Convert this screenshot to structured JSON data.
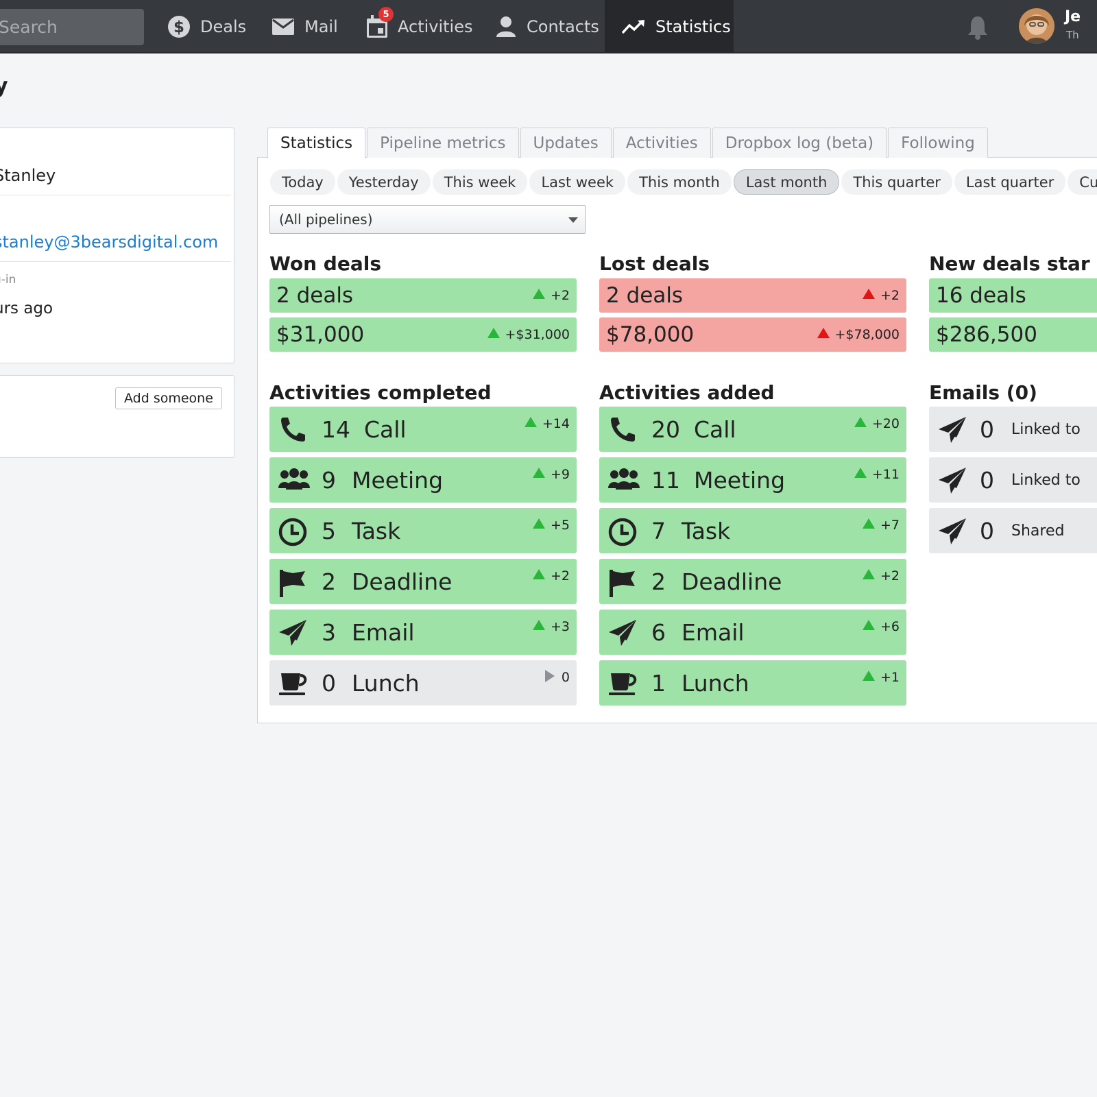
{
  "nav": {
    "search_placeholder": "Search",
    "items": [
      {
        "label": "Deals",
        "icon": "dollar-icon"
      },
      {
        "label": "Mail",
        "icon": "mail-icon"
      },
      {
        "label": "Activities",
        "icon": "calendar-icon",
        "badge": "5"
      },
      {
        "label": "Contacts",
        "icon": "person-icon"
      },
      {
        "label": "Statistics",
        "icon": "trend-icon",
        "active": true
      }
    ],
    "user_name": "Je",
    "user_company": "Th"
  },
  "page_title": "y",
  "profile": {
    "name": "Stanley",
    "email": "stanley@3bearsdigital.com",
    "last_login_label": "g-in",
    "last_login_value": "urs ago"
  },
  "followers": {
    "add_button": "Add someone"
  },
  "tabs": [
    "Statistics",
    "Pipeline metrics",
    "Updates",
    "Activities",
    "Dropbox log (beta)",
    "Following"
  ],
  "periods": [
    "Today",
    "Yesterday",
    "This week",
    "Last week",
    "This month",
    "Last month",
    "This quarter",
    "Last quarter",
    "Cust"
  ],
  "active_period": "Last month",
  "pipeline_select": "(All pipelines)",
  "won": {
    "title": "Won deals",
    "count": "2 deals",
    "count_delta": "+2",
    "value": "$31,000",
    "value_delta": "+$31,000"
  },
  "lost": {
    "title": "Lost deals",
    "count": "2 deals",
    "count_delta": "+2",
    "value": "$78,000",
    "value_delta": "+$78,000"
  },
  "new_deals": {
    "title": "New deals star",
    "count": "16 deals",
    "value": "$286,500"
  },
  "activities_completed": {
    "title": "Activities completed",
    "rows": [
      {
        "icon": "phone-icon",
        "num": "14",
        "label": "Call",
        "delta": "+14",
        "trend": "up"
      },
      {
        "icon": "group-icon",
        "num": "9",
        "label": "Meeting",
        "delta": "+9",
        "trend": "up"
      },
      {
        "icon": "clock-icon",
        "num": "5",
        "label": "Task",
        "delta": "+5",
        "trend": "up"
      },
      {
        "icon": "flag-icon",
        "num": "2",
        "label": "Deadline",
        "delta": "+2",
        "trend": "up"
      },
      {
        "icon": "send-icon",
        "num": "3",
        "label": "Email",
        "delta": "+3",
        "trend": "up"
      },
      {
        "icon": "coffee-icon",
        "num": "0",
        "label": "Lunch",
        "delta": "0",
        "trend": "flat"
      }
    ]
  },
  "activities_added": {
    "title": "Activities added",
    "rows": [
      {
        "icon": "phone-icon",
        "num": "20",
        "label": "Call",
        "delta": "+20",
        "trend": "up"
      },
      {
        "icon": "group-icon",
        "num": "11",
        "label": "Meeting",
        "delta": "+11",
        "trend": "up"
      },
      {
        "icon": "clock-icon",
        "num": "7",
        "label": "Task",
        "delta": "+7",
        "trend": "up"
      },
      {
        "icon": "flag-icon",
        "num": "2",
        "label": "Deadline",
        "delta": "+2",
        "trend": "up"
      },
      {
        "icon": "send-icon",
        "num": "6",
        "label": "Email",
        "delta": "+6",
        "trend": "up"
      },
      {
        "icon": "coffee-icon",
        "num": "1",
        "label": "Lunch",
        "delta": "+1",
        "trend": "up"
      }
    ]
  },
  "emails": {
    "title": "Emails (0)",
    "rows": [
      {
        "icon": "send-icon",
        "num": "0",
        "label": "Linked to"
      },
      {
        "icon": "send-icon",
        "num": "0",
        "label": "Linked to"
      },
      {
        "icon": "send-icon",
        "num": "0",
        "label": "Shared"
      }
    ]
  },
  "colors": {
    "nav_bg": "#36393d",
    "positive": "#9fe2a7",
    "negative": "#f4a5a1",
    "neutral": "#e8e9ea",
    "link": "#1a7fd4"
  }
}
